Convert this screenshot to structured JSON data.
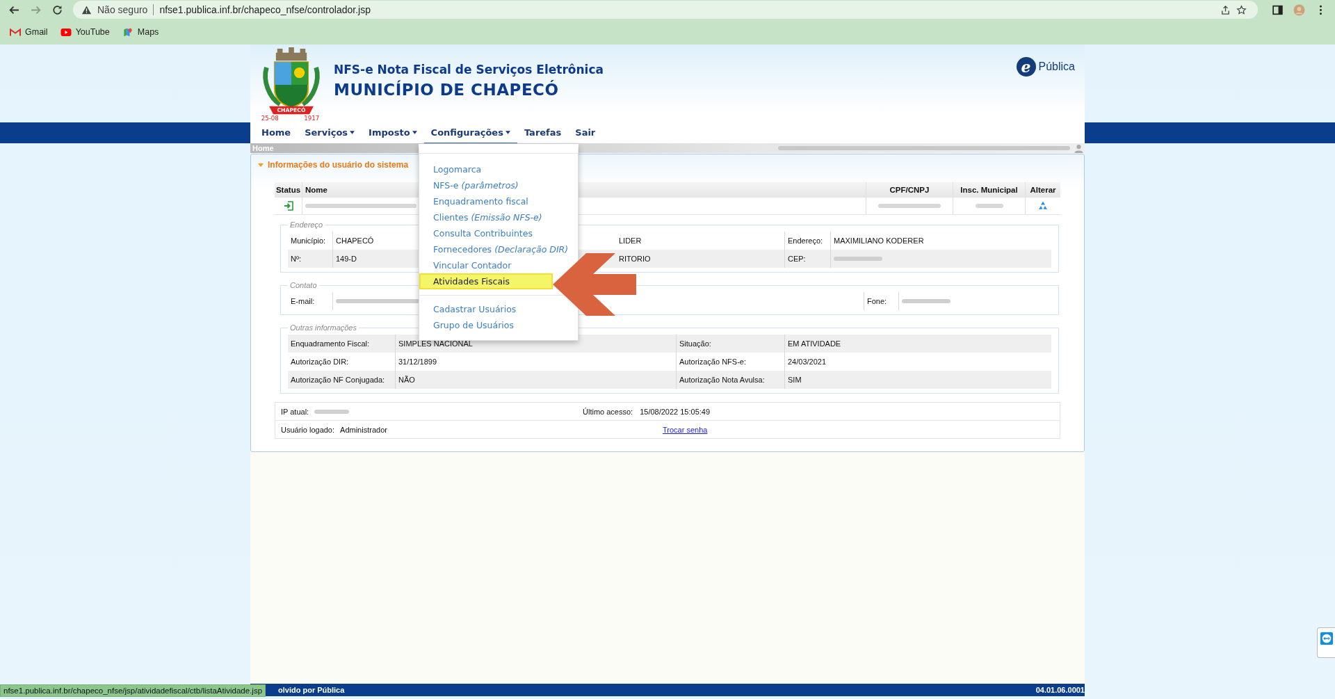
{
  "browser": {
    "security": "Não seguro",
    "url": "nfse1.publica.inf.br/chapeco_nfse/controlador.jsp",
    "forward_disabled": true,
    "bookmarks": [
      {
        "kind": "gmail",
        "label": "Gmail"
      },
      {
        "kind": "youtube",
        "label": "YouTube"
      },
      {
        "kind": "maps",
        "label": "Maps"
      }
    ]
  },
  "header": {
    "logo": {
      "ribbon": "CHAPECÓ",
      "dates": [
        "25-08",
        "1917"
      ]
    },
    "title": "NFS-e Nota Fiscal de Serviços Eletrônica",
    "subtitle": "MUNICÍPIO DE CHAPECÓ",
    "brand": {
      "mark": "e",
      "name": "Pública"
    }
  },
  "nav": [
    {
      "label": "Home",
      "has_menu": false,
      "selected": false
    },
    {
      "label": "Serviços",
      "has_menu": true,
      "selected": false
    },
    {
      "label": "Imposto",
      "has_menu": true,
      "selected": false
    },
    {
      "label": "Configurações",
      "has_menu": true,
      "selected": true
    },
    {
      "label": "Tarefas",
      "has_menu": false,
      "selected": false
    },
    {
      "label": "Sair",
      "has_menu": false,
      "selected": false
    }
  ],
  "breadcrumb": "Home",
  "section": {
    "title": "Informações do usuário do sistema",
    "expanded": true
  },
  "table": {
    "columns": [
      "Status",
      "Nome",
      "CPF/CNPJ",
      "Insc. Municipal",
      "Alterar"
    ]
  },
  "endereco": {
    "legend": "Endereço",
    "rows": [
      {
        "label": "Município:",
        "value": "CHAPECÓ",
        "middle": "LIDER",
        "label2": "Endereço:",
        "value2": "MAXIMILIANO KODERER",
        "value2_redacted": false
      },
      {
        "label": "Nº:",
        "value": "149-D",
        "middle": "RITORIO",
        "label2": "CEP:",
        "value2_redacted": true
      }
    ]
  },
  "contato": {
    "legend": "Contato",
    "email_label": "E-mail:",
    "phone_label": "Fone:"
  },
  "outras": {
    "legend": "Outras informações",
    "rows": [
      {
        "label": "Enquadramento Fiscal:",
        "value": "SIMPLES NACIONAL",
        "label2": "Situação:",
        "value2": "EM ATIVIDADE"
      },
      {
        "label": "Autorização DIR:",
        "value": "31/12/1899",
        "label2": "Autorização NFS-e:",
        "value2": "24/03/2021"
      },
      {
        "label": "Autorização NF Conjugada:",
        "value": "NÃO",
        "label2": "Autorização Nota Avulsa:",
        "value2": "SIM"
      }
    ]
  },
  "session": {
    "ip_label": "IP atual:",
    "last_access_label": "Último acesso:",
    "last_access": "15/08/2022 15:05:49",
    "user_label": "Usuário logado:",
    "user": "Administrador",
    "change_password": "Trocar senha"
  },
  "menu": {
    "groups": [
      [
        {
          "label": "Logomarca",
          "selected": false
        },
        {
          "label": "NFS-e",
          "note": "(parâmetros)",
          "selected": false
        },
        {
          "label": "Enquadramento fiscal",
          "selected": false
        },
        {
          "label": "Clientes",
          "note": "(Emissão NFS-e)",
          "selected": false
        },
        {
          "label": "Consulta Contribuintes",
          "selected": false
        },
        {
          "label": "Fornecedores",
          "note": "(Declaração DIR)",
          "selected": false
        },
        {
          "label": "Vincular Contador",
          "selected": false
        },
        {
          "label": "Atividades Fiscais",
          "selected": true
        }
      ],
      [
        {
          "label": "Cadastrar Usuários",
          "selected": false
        },
        {
          "label": "Grupo de Usuários",
          "selected": false
        }
      ]
    ]
  },
  "footer": {
    "credit": "olvido por Pública",
    "version": "04.01.06.0001"
  },
  "status_link": "nfse1.publica.inf.br/chapeco_nfse/jsp/atividadefiscal/ctb/listaAtividade.jsp"
}
